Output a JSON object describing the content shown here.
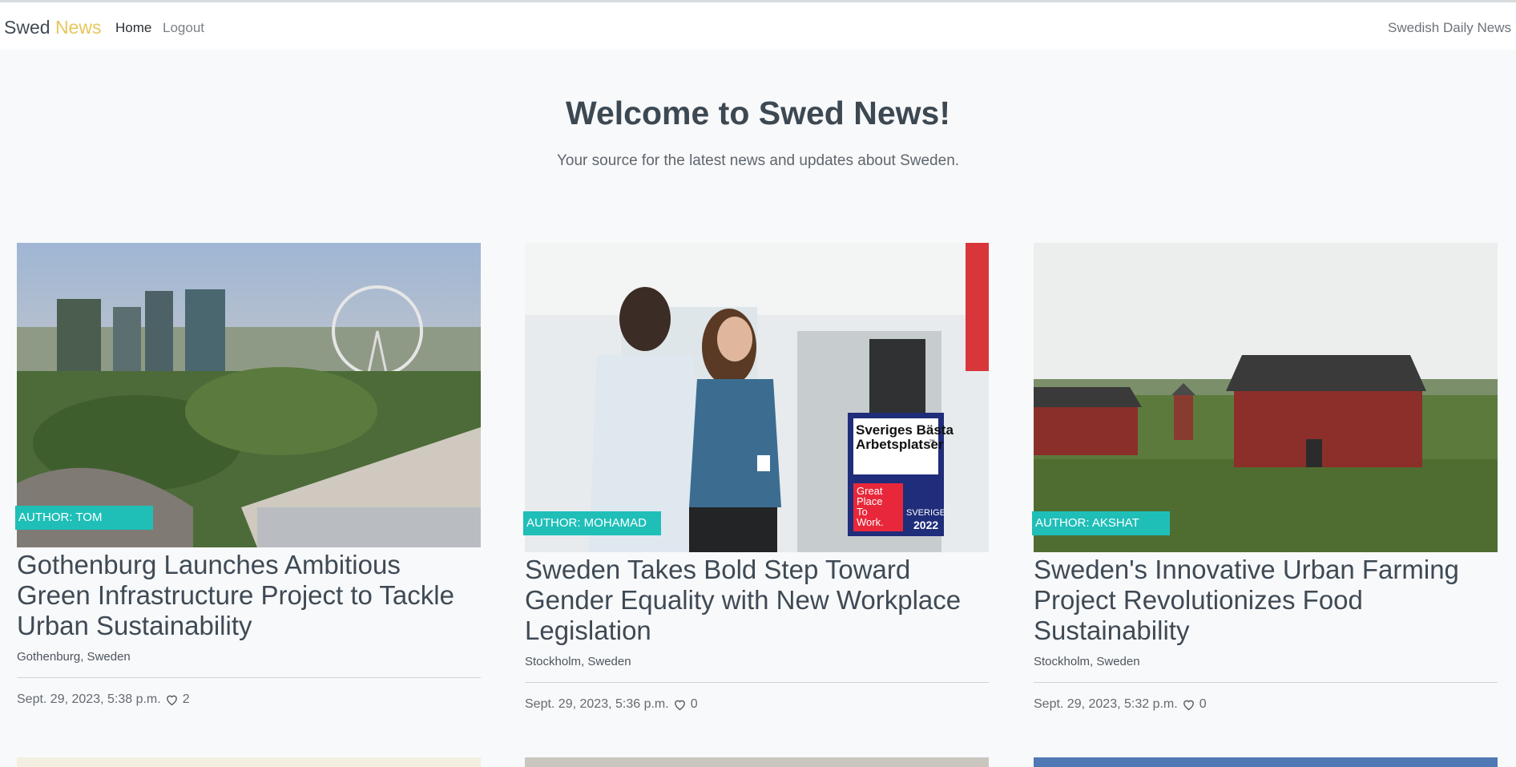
{
  "navbar": {
    "brand_part1": "Swed",
    "brand_part2": "News",
    "home_label": "Home",
    "logout_label": "Logout",
    "right_text": "Swedish Daily News"
  },
  "hero": {
    "title": "Welcome to Swed News!",
    "subtitle": "Your source for the latest news and updates about Sweden."
  },
  "articles": [
    {
      "author": "AUTHOR: TOM",
      "title": "Gothenburg Launches Ambitious Green Infrastructure Project to Tackle Urban Sustainability",
      "location": "Gothenburg, Sweden",
      "date": "Sept. 29, 2023, 5:38 p.m.",
      "likes": "2"
    },
    {
      "author": "AUTHOR: MOHAMAD",
      "title": "Sweden Takes Bold Step Toward Gender Equality with New Workplace Legislation",
      "location": "Stockholm, Sweden",
      "date": "Sept. 29, 2023, 5:36 p.m.",
      "likes": "0",
      "image_logo": {
        "line1": "Sveriges Bästa",
        "line2": "Arbetsplatser",
        "tm": "™",
        "red1": "Great",
        "red2": "Place",
        "red3": "To",
        "red4": "Work.",
        "country": "SVERIGE",
        "year": "2022"
      }
    },
    {
      "author": "AUTHOR: AKSHAT",
      "title": "Sweden's Innovative Urban Farming Project Revolutionizes Food Sustainability",
      "location": "Stockholm, Sweden",
      "date": "Sept. 29, 2023, 5:32 p.m.",
      "likes": "0"
    }
  ],
  "colors": {
    "brand_accent": "#e8c65c",
    "author_badge": "#1fbfb8",
    "background": "#f8f9fa"
  },
  "icons": {
    "like": "heart-outline-icon"
  }
}
